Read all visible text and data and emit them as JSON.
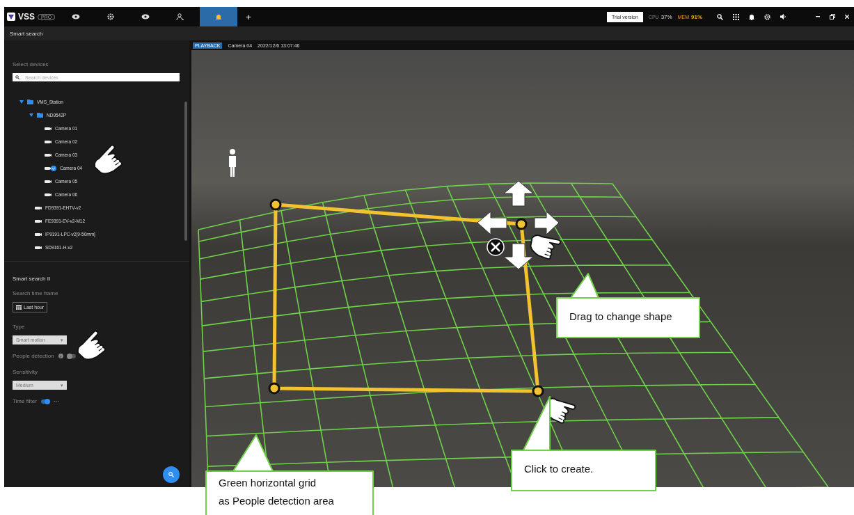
{
  "app": {
    "logo": "VSS",
    "edition": "PRO"
  },
  "tabs": [
    {
      "kind": "eye",
      "selected": false
    },
    {
      "kind": "gear",
      "selected": false
    },
    {
      "kind": "eye",
      "selected": false
    },
    {
      "kind": "person-search",
      "selected": false
    },
    {
      "kind": "bell",
      "selected": true
    }
  ],
  "add_tab": "+",
  "trial": "Trial version",
  "cpu": {
    "label": "CPU",
    "value": "37%"
  },
  "mem": {
    "label": "MEM",
    "value": "91%"
  },
  "page_title": "Smart search",
  "devices": {
    "heading": "Select devices",
    "placeholder": "Search devices",
    "tree": [
      {
        "name": "VMS_Station",
        "kind": "folder",
        "expanded": true,
        "children": [
          {
            "name": "ND9542P",
            "kind": "folder",
            "expanded": true,
            "children": [
              {
                "name": "Camera 01",
                "kind": "camera",
                "checked": false
              },
              {
                "name": "Camera 02",
                "kind": "camera",
                "checked": false
              },
              {
                "name": "Camera 03",
                "kind": "camera",
                "checked": false
              },
              {
                "name": "Camera 04",
                "kind": "camera",
                "checked": true
              },
              {
                "name": "Camera 05",
                "kind": "camera",
                "checked": false
              },
              {
                "name": "Camera 06",
                "kind": "camera",
                "checked": false
              }
            ]
          },
          {
            "name": "FD9391-EHTV-v2",
            "kind": "camera",
            "checked": false
          },
          {
            "name": "FE9391-EV-v2-M12",
            "kind": "camera",
            "checked": false
          },
          {
            "name": "IP9191-LPC-v2[9-50mm]",
            "kind": "camera",
            "checked": false
          },
          {
            "name": "SD9161-H-v2",
            "kind": "camera",
            "checked": false
          }
        ]
      }
    ]
  },
  "search": {
    "title": "Smart search II",
    "time_label": "Search time frame",
    "time_button": "Last hour",
    "type_label": "Type",
    "type_value": "Smart motion",
    "dropdown_caret": "▾",
    "people_label": "People detection",
    "people_on": false,
    "sensitivity_label": "Sensitivity",
    "sensitivity_value": "Medium",
    "time_filter_label": "Time filter",
    "time_filter_on": true,
    "more": "···"
  },
  "player": {
    "badge": "PLAYBACK",
    "camera": "Camera 04",
    "time": "2022/12/6 13:07:46"
  },
  "callouts": [
    {
      "lines": [
        "Drag to change shape"
      ]
    },
    {
      "lines": [
        "Click to create."
      ]
    },
    {
      "lines": [
        "Green horizontal grid",
        "as People detection area"
      ]
    }
  ]
}
